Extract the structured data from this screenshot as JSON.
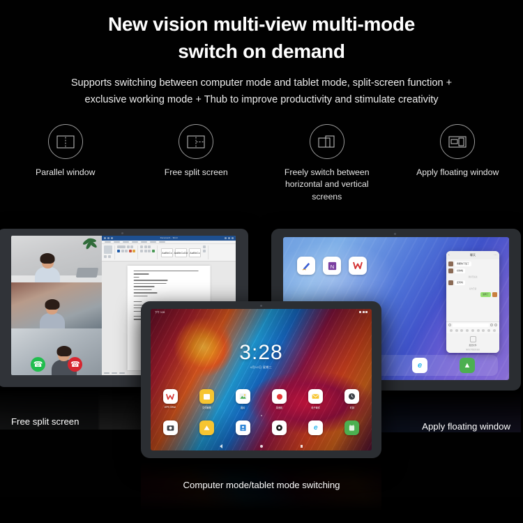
{
  "header": {
    "title_line1": "New vision multi-view multi-mode",
    "title_line2": "switch on demand",
    "subtitle_line1": "Supports switching between computer mode and tablet mode, split-screen function +",
    "subtitle_line2": "exclusive working mode + Thub to improve productivity and stimulate creativity"
  },
  "features": [
    {
      "label": "Parallel window",
      "icon": "parallel-window-icon"
    },
    {
      "label": "Free split screen",
      "icon": "free-split-screen-icon"
    },
    {
      "label": "Freely switch between horizontal and vertical screens",
      "icon": "rotate-screen-icon"
    },
    {
      "label": "Apply floating window",
      "icon": "floating-window-icon"
    }
  ],
  "captions": {
    "left": "Free split screen",
    "right": "Apply floating window",
    "center": "Computer mode/tablet mode switching"
  },
  "left_tablet": {
    "name": "split-screen-tablet",
    "video_call": {
      "participants": [
        "participant-top",
        "participant-middle",
        "participant-bottom"
      ],
      "accept_icon": "phone-accept-icon",
      "decline_icon": "phone-decline-icon"
    },
    "document": {
      "app": "word-processor",
      "title": "Document1 - Word",
      "ribbon_styles": [
        "AaBbCc",
        "AaBbCcDd",
        "AaBbCc"
      ]
    }
  },
  "right_tablet": {
    "name": "floating-window-tablet",
    "home_apps": [
      {
        "name": "notes-app-icon",
        "glyph": "✎",
        "color": "#3b5fd4",
        "bg": "#ffffff"
      },
      {
        "name": "onenote-app-icon",
        "glyph": "N",
        "color": "#7b3fa0",
        "bg": "#ffffff"
      },
      {
        "name": "wps-office-app-icon",
        "glyph": "W",
        "color": "#d32f2f",
        "bg": "#ffffff"
      }
    ],
    "dock_apps": [
      {
        "name": "contacts-dock-icon",
        "glyph": "▤",
        "color": "#2f86d6",
        "bg": "#ffffff"
      },
      {
        "name": "settings-dock-icon",
        "glyph": "⚙",
        "color": "#1b1b1b",
        "bg": "#ffffff"
      },
      {
        "name": "browser-dock-icon",
        "glyph": "e",
        "color": "#2bb7ee",
        "bg": "#ffffff"
      },
      {
        "name": "market-dock-icon",
        "glyph": "▲",
        "color": "#ffffff",
        "bg": "#4caf50"
      }
    ],
    "chat_window": {
      "name": "chat-floating-window",
      "title": "聊天",
      "back_icon": "back-chevron-icon",
      "more_icon": "more-dots-icon",
      "messages": [
        {
          "from": "other",
          "text": "我都快下班了"
        },
        {
          "from": "other",
          "text": "好的啦"
        },
        {
          "from": "other",
          "text": "还有吗"
        },
        {
          "from": "me",
          "text": "没有了"
        }
      ],
      "system_notes": [
        "消息已送达",
        "对方已读"
      ],
      "footer_title": "发送文件",
      "footer_sub": "拖拽文件到此处发送"
    }
  },
  "center_tablet": {
    "name": "tablet-mode-device",
    "status_bar": {
      "carrier": "下午 3:28",
      "battery_icon": "battery-icon",
      "signal_icon": "signal-icon",
      "wifi_icon": "wifi-icon"
    },
    "clock": {
      "time": "3:28",
      "date": "4月12日 星期三"
    },
    "apps_row1": [
      {
        "name": "wps-office-icon",
        "label": "WPS Office",
        "glyph": "W",
        "color": "#d32f2f",
        "bg": "#ffffff"
      },
      {
        "name": "file-manager-icon",
        "label": "文件管理",
        "glyph": "▮",
        "color": "#ffffff",
        "bg": "#f7c531"
      },
      {
        "name": "gallery-icon",
        "label": "图片",
        "glyph": "▦",
        "color": "#4caf50",
        "bg": "#ffffff"
      },
      {
        "name": "recorder-icon",
        "label": "录音机",
        "glyph": "●",
        "color": "#e53935",
        "bg": "#ffffff"
      },
      {
        "name": "email-icon",
        "label": "电子邮件",
        "glyph": "✉",
        "color": "#f7c531",
        "bg": "#ffffff"
      },
      {
        "name": "clock-icon",
        "label": "时钟",
        "glyph": "◉",
        "color": "#333333",
        "bg": "#ffffff"
      }
    ],
    "apps_row2": [
      {
        "name": "camera-icon",
        "label": "",
        "glyph": "▣",
        "color": "#333333",
        "bg": "#ffffff"
      },
      {
        "name": "photos-icon",
        "label": "",
        "glyph": "▲",
        "color": "#ffffff",
        "bg": "#f7c531"
      },
      {
        "name": "contacts-icon",
        "label": "",
        "glyph": "▤",
        "color": "#2f86d6",
        "bg": "#ffffff"
      },
      {
        "name": "settings-icon",
        "label": "",
        "glyph": "⚙",
        "color": "#1b1b1b",
        "bg": "#ffffff"
      },
      {
        "name": "browser-icon",
        "label": "",
        "glyph": "e",
        "color": "#2bb7ee",
        "bg": "#ffffff"
      },
      {
        "name": "market-icon",
        "label": "",
        "glyph": "▲",
        "color": "#ffffff",
        "bg": "#4caf50"
      }
    ],
    "nav_bar": {
      "back": "nav-back-icon",
      "home": "nav-home-icon",
      "recents": "nav-recents-icon"
    }
  },
  "colors": {
    "background": "#010101",
    "text": "#ffffff",
    "icon_stroke": "#9a9a9a",
    "accept_green": "#21bd4e",
    "decline_red": "#d62630",
    "word_blue": "#1e4f8f"
  }
}
